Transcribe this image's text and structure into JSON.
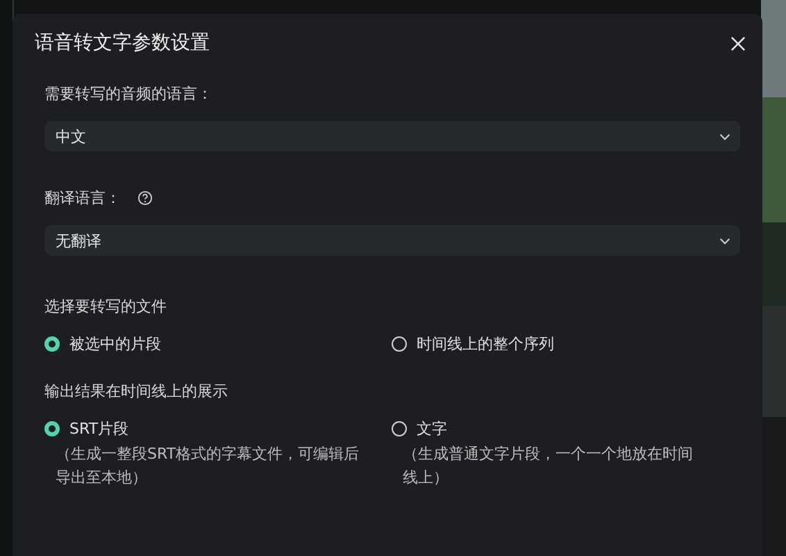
{
  "dialog": {
    "title": "语音转文字参数设置"
  },
  "fields": [
    {
      "label": "需要转写的音频的语言：",
      "value": "中文",
      "help": false
    },
    {
      "label": "翻译语言：",
      "value": "无翻译",
      "help": true
    }
  ],
  "groups": [
    {
      "title": "选择要转写的文件",
      "options": [
        {
          "label": "被选中的片段",
          "selected": true
        },
        {
          "label": "时间线上的整个序列",
          "selected": false
        }
      ]
    },
    {
      "title": "输出结果在时间线上的展示",
      "options": [
        {
          "label": "SRT片段",
          "note": "（生成一整段SRT格式的字幕文件，可编辑后导出至本地）",
          "selected": true
        },
        {
          "label": "文字",
          "note": "（生成普通文字片段，一个一个地放在时间线上）",
          "selected": false
        }
      ]
    }
  ]
}
